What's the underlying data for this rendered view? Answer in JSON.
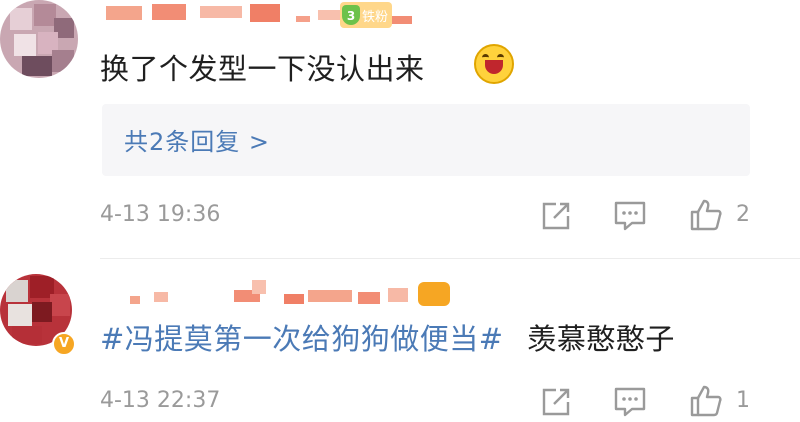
{
  "comments": [
    {
      "name": "",
      "fan_badge": {
        "level": "3",
        "label": "铁粉"
      },
      "text": "换了个发型一下没认出来",
      "emoji": "laughing-emoji",
      "replies_link": "共2条回复 >",
      "timestamp": "4-13 19:36",
      "likes": "2"
    },
    {
      "name": "",
      "verified": "V",
      "hashtag": "#冯提莫第一次给狗狗做便当#",
      "text": "羡慕憨憨子",
      "timestamp": "4-13 22:37",
      "likes": "1"
    }
  ],
  "colors": {
    "link": "#4b7ab6",
    "meta": "#9a9a9a",
    "reply_box_bg": "#f6f6f8",
    "fan_badge": "#ffd78a",
    "verified": "#f6a623"
  },
  "icons": {
    "share": "share-icon",
    "comment": "comment-icon",
    "like": "thumbs-up-icon"
  }
}
